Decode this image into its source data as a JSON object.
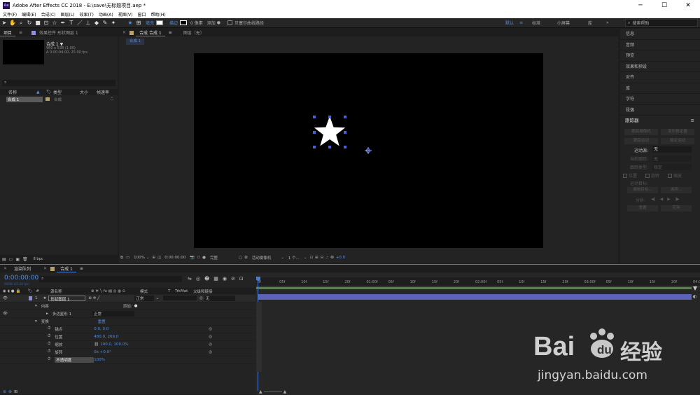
{
  "window": {
    "title": "Adobe After Effects CC 2018 - E:\\save\\无标题项目.aep *",
    "logo": "Ae",
    "minimize": "─",
    "maximize": "☐",
    "close": "✕"
  },
  "menu": [
    "文件(F)",
    "编辑(E)",
    "合成(C)",
    "图层(L)",
    "效果(T)",
    "动画(A)",
    "视图(V)",
    "窗口",
    "帮助(H)"
  ],
  "toolbar": {
    "fill_label": "填充",
    "stroke_label": "描边",
    "stroke_width": "0 像素",
    "add_label": "添加",
    "bezier_label": "贝塞尔曲线路径",
    "workspaces": [
      "默认",
      "标准",
      "小屏幕",
      "库"
    ],
    "search_placeholder": "搜索帮助"
  },
  "project_panel": {
    "tab_project": "项目",
    "tab_effects": "效果控件 形状图层 1",
    "comp_name": "合成 1 ▼",
    "comp_size": "960 x 538 (1.00)",
    "comp_duration": "Δ 0:00:04:00, 25.00 fps",
    "search_icon": "⌕",
    "columns": [
      "名称",
      "类型",
      "大小",
      "帧速率"
    ],
    "item_name": "合成 1",
    "item_type": "合成",
    "bpc": "8 bpc"
  },
  "comp_panel": {
    "tab": "合成 合成 1",
    "tab_layer": "图层（无）",
    "subtab": "合成 1",
    "zoom": "100%",
    "timecode": "0:00:00:00",
    "quality": "完整",
    "camera": "活动摄像机",
    "views": "1 个...",
    "exposure": "+0.0"
  },
  "right_panel": {
    "items": [
      "信息",
      "音频",
      "预览",
      "效果和预设",
      "对齐",
      "库",
      "字符",
      "段落"
    ],
    "tracker_title": "跟踪器",
    "tracker_buttons": [
      "跟踪摄像机",
      "变形稳定器",
      "跟踪运动",
      "稳定运动"
    ],
    "motion_source_label": "运动源:",
    "motion_source_value": "无",
    "current_track_label": "当前跟踪:",
    "current_track_value": "无",
    "track_type_label": "跟踪类型:",
    "track_type_value": "稳定",
    "check_position": "位置",
    "check_rotation": "旋转",
    "check_scale": "缩放",
    "motion_target": "运动目标:",
    "edit_target": "编辑目标...",
    "options": "选项...",
    "analyze": "分析:",
    "reset": "重置",
    "apply": "应用"
  },
  "timeline": {
    "tab_render": "渲染队列",
    "tab_comp": "合成 1",
    "timecode": "0:00:00:00",
    "timecode_sub": "00000 (25.00 fps)",
    "columns": {
      "number": "#",
      "source": "源名称",
      "mode": "模式",
      "t": "T",
      "trkmat": "TrkMat",
      "parent": "父级和链接"
    },
    "layer_num": "1",
    "layer_name": "形状图层 1",
    "layer_mode": "正常",
    "layer_parent": "无",
    "contents": "内容",
    "add": "添加:",
    "polystar": "多边星形 1",
    "polystar_mode": "正常",
    "transform": "变换",
    "reset": "重置",
    "props": [
      {
        "name": "锚点",
        "value": "0.0, 0.0"
      },
      {
        "name": "位置",
        "value": "480.0, 269.0"
      },
      {
        "name": "缩放",
        "value": "100.0, 100.0%"
      },
      {
        "name": "旋转",
        "value": "0x +0.0°"
      },
      {
        "name": "不透明度",
        "value": "100%"
      }
    ],
    "ruler": [
      "0f",
      "05f",
      "10f",
      "15f",
      "20f",
      "01:00f",
      "05f",
      "10f",
      "15f",
      "20f",
      "02:00f",
      "05f",
      "10f",
      "15f",
      "20f",
      "03:00f",
      "05f",
      "10f",
      "15f",
      "20f",
      "04:0"
    ]
  },
  "watermark": {
    "brand": "Bai",
    "brand2": "经验",
    "url": "jingyan.baidu.com"
  },
  "colors": {
    "accent": "#4d7bd1",
    "layer_bar": "#5b62b8",
    "label_purple": "#8c8ce0"
  }
}
